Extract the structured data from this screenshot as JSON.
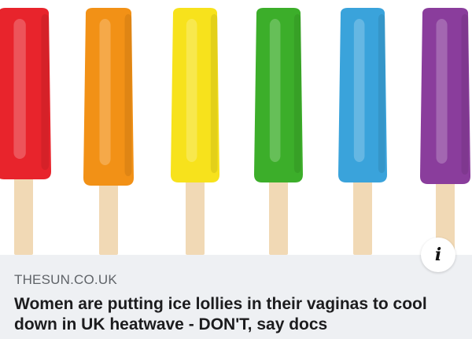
{
  "image": {
    "subject": "ice lollies",
    "lollies": [
      {
        "name": "red",
        "color": "#e8242c"
      },
      {
        "name": "orange",
        "color": "#f29116"
      },
      {
        "name": "yellow",
        "color": "#f7e21c"
      },
      {
        "name": "green",
        "color": "#3cae2a"
      },
      {
        "name": "blue",
        "color": "#3aa3db"
      },
      {
        "name": "purple",
        "color": "#8a3d9c"
      }
    ],
    "stick_color": "#f1d9b5"
  },
  "info_button": {
    "icon": "info-icon",
    "glyph": "i"
  },
  "link_preview": {
    "source": "THESUN.CO.UK",
    "headline": "Women are putting ice lollies in their vaginas to cool down in UK heatwave - DON'T, say docs"
  },
  "colors": {
    "caption_bg": "#eef0f3",
    "source_text": "#5f6368",
    "headline_text": "#1c1c1e"
  }
}
